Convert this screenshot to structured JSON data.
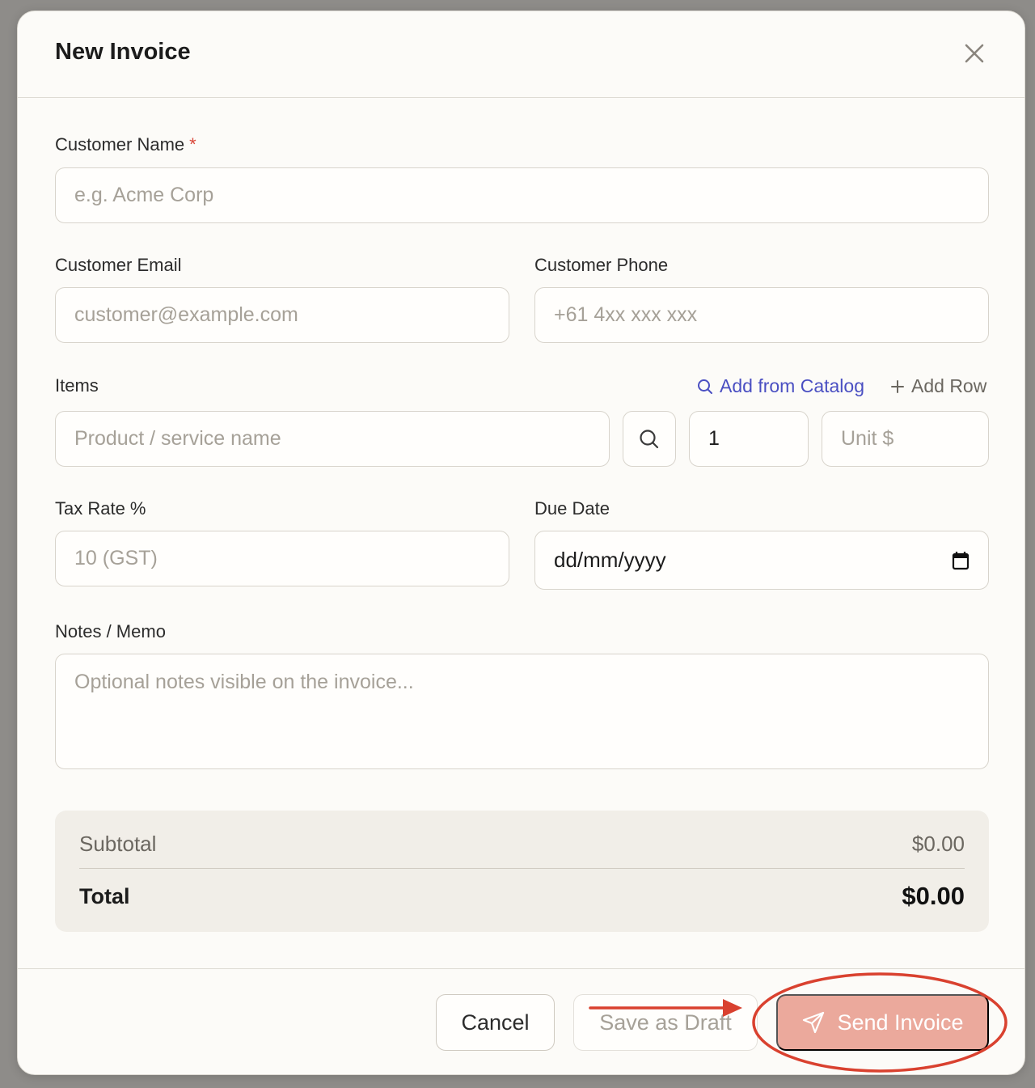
{
  "modal": {
    "title": "New Invoice"
  },
  "form": {
    "customer_name": {
      "label": "Customer Name",
      "required_mark": "*",
      "placeholder": "e.g. Acme Corp",
      "value": ""
    },
    "customer_email": {
      "label": "Customer Email",
      "placeholder": "customer@example.com",
      "value": ""
    },
    "customer_phone": {
      "label": "Customer Phone",
      "placeholder": "+61 4xx xxx xxx",
      "value": ""
    },
    "items": {
      "label": "Items",
      "add_from_catalog": "Add from Catalog",
      "add_row": "Add Row",
      "row": {
        "product_placeholder": "Product / service name",
        "quantity": "1",
        "unit_price_placeholder": "Unit $"
      }
    },
    "tax_rate": {
      "label": "Tax Rate %",
      "placeholder": "10 (GST)",
      "value": ""
    },
    "due_date": {
      "label": "Due Date",
      "display": "dd/mm/yyyy"
    },
    "notes": {
      "label": "Notes / Memo",
      "placeholder": "Optional notes visible on the invoice..."
    }
  },
  "summary": {
    "subtotal_label": "Subtotal",
    "subtotal_value": "$0.00",
    "total_label": "Total",
    "total_value": "$0.00"
  },
  "footer": {
    "cancel_label": "Cancel",
    "save_draft_label": "Save as Draft",
    "send_label": "Send Invoice"
  },
  "colors": {
    "link_accent": "#4a4fc2",
    "send_button": "#eba99c",
    "annotation": "#d9412f",
    "required": "#d9473a"
  },
  "icons": {
    "close": "close-icon",
    "catalog_search": "search-icon",
    "add": "plus-icon",
    "item_search": "search-icon",
    "calendar": "calendar-icon",
    "send": "send-icon"
  }
}
